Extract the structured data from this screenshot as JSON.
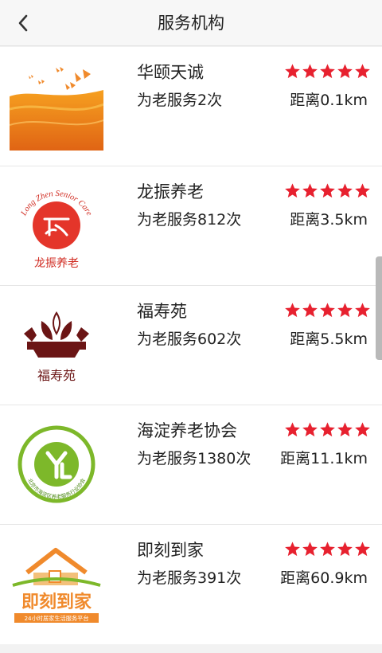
{
  "header": {
    "title": "服务机构",
    "back_icon": "chevron-left-icon"
  },
  "colors": {
    "star": "#e7212f",
    "text": "#222222"
  },
  "organizations": [
    {
      "name": "华颐天诚",
      "service_count": "为老服务2次",
      "distance": "距离0.1km",
      "rating": 5
    },
    {
      "name": "龙振养老",
      "service_count": "为老服务812次",
      "distance": "距离3.5km",
      "rating": 5,
      "logo_text": "Long Zhen Senior Care",
      "logo_caption": "龙振养老"
    },
    {
      "name": "福寿苑",
      "service_count": "为老服务602次",
      "distance": "距离5.5km",
      "rating": 5,
      "logo_caption": "福寿苑"
    },
    {
      "name": "海淀养老协会",
      "service_count": "为老服务1380次",
      "distance": "距离11.1km",
      "rating": 5,
      "logo_text": "北京市海淀区养老服务行业协会"
    },
    {
      "name": "即刻到家",
      "service_count": "为老服务391次",
      "distance": "距离60.9km",
      "rating": 5,
      "logo_caption": "即刻到家",
      "logo_text": "24小时居家生活服务平台"
    }
  ]
}
